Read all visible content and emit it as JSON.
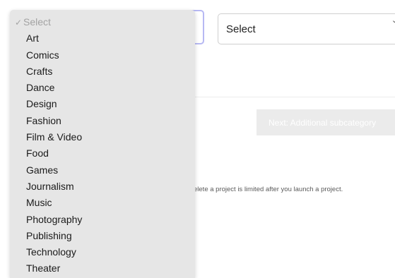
{
  "category_select": {
    "placeholder_option": "Select",
    "checkmark": "✓",
    "options": [
      "Art",
      "Comics",
      "Crafts",
      "Dance",
      "Design",
      "Fashion",
      "Film & Video",
      "Food",
      "Games",
      "Journalism",
      "Music",
      "Photography",
      "Publishing",
      "Technology",
      "Theater"
    ]
  },
  "subcategory_select": {
    "value": "Select"
  },
  "next_button": {
    "label": "Next: Additional subcategory"
  },
  "note": {
    "text": "elete a project is limited after you launch a project."
  },
  "colors": {
    "focus_border": "#b7b9f3",
    "dropdown_bg": "#e6e6e6",
    "button_disabled_bg": "#ebebeb"
  }
}
